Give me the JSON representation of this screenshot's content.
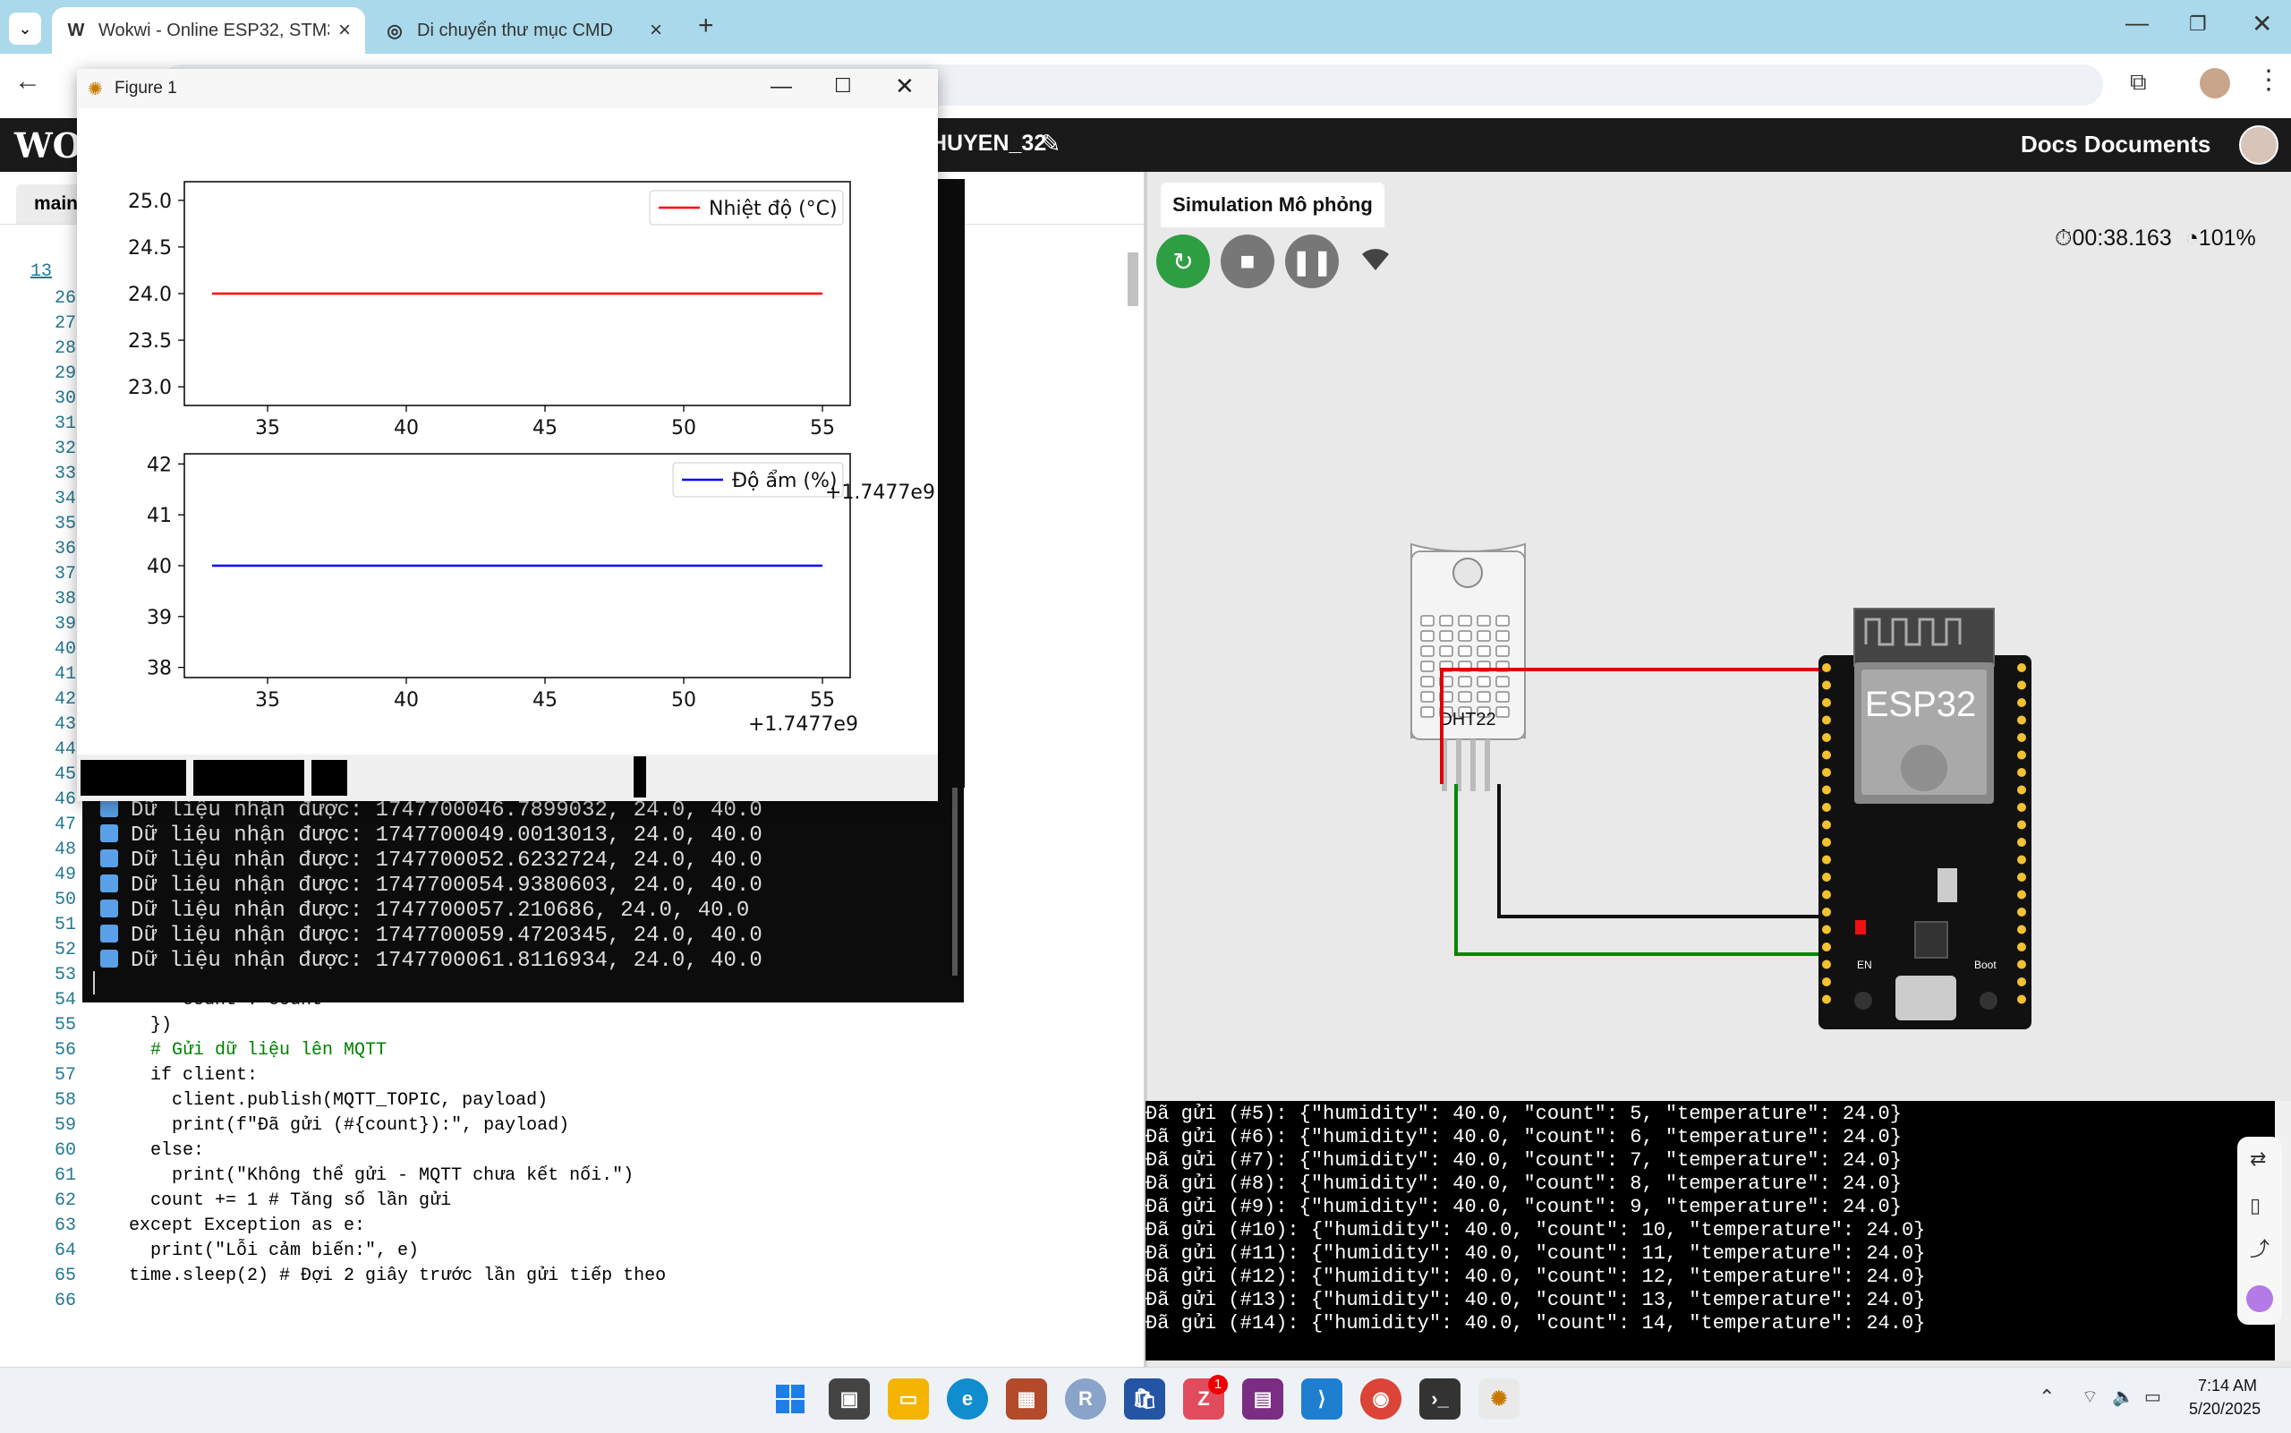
{
  "browser": {
    "tabs": [
      {
        "title": "Wokwi - Online ESP32, STM32,",
        "icon": "wokwi-icon"
      },
      {
        "title": "Di chuyển thư mục CMD",
        "icon": "openai-icon"
      }
    ]
  },
  "wokwi": {
    "logo": "WOK",
    "project_name": "HUYEN_32",
    "docs_label": "Docs Documents",
    "editor_tab": "main",
    "simulation_tab": "Simulation Mô phỏng",
    "timer": "00:38.163",
    "speed": "101%"
  },
  "editor": {
    "first_gutter": "13",
    "lines": [
      {
        "n": "26",
        "t": ""
      },
      {
        "n": "27",
        "t": ""
      },
      {
        "n": "28",
        "t": ""
      },
      {
        "n": "29",
        "t": ""
      },
      {
        "n": "30",
        "t": ""
      },
      {
        "n": "31",
        "t": ""
      },
      {
        "n": "32",
        "t": ""
      },
      {
        "n": "33",
        "t": ""
      },
      {
        "n": "34",
        "t": ""
      },
      {
        "n": "35",
        "t": ""
      },
      {
        "n": "36",
        "t": ""
      },
      {
        "n": "37",
        "t": ""
      },
      {
        "n": "38",
        "t": ""
      },
      {
        "n": "39",
        "t": ""
      },
      {
        "n": "40",
        "t": ""
      },
      {
        "n": "41",
        "t": ""
      },
      {
        "n": "42",
        "t": ""
      },
      {
        "n": "43",
        "t": ""
      },
      {
        "n": "44",
        "t": ""
      },
      {
        "n": "45",
        "t": ""
      },
      {
        "n": "46",
        "t": ""
      },
      {
        "n": "47",
        "t": ""
      },
      {
        "n": "48",
        "t": ""
      },
      {
        "n": "49",
        "t": ""
      },
      {
        "n": "50",
        "t": ""
      },
      {
        "n": "51",
        "t": ""
      },
      {
        "n": "52",
        "t": ""
      },
      {
        "n": "53",
        "t": ""
      },
      {
        "n": "54",
        "t": "        \"count\": count"
      },
      {
        "n": "55",
        "t": "      })"
      },
      {
        "n": "56",
        "t": "      # Gửi dữ liệu lên MQTT"
      },
      {
        "n": "57",
        "t": "      if client:"
      },
      {
        "n": "58",
        "t": "        client.publish(MQTT_TOPIC, payload)"
      },
      {
        "n": "59",
        "t": "        print(f\"Đã gửi (#{count}):\", payload)"
      },
      {
        "n": "60",
        "t": "      else:"
      },
      {
        "n": "61",
        "t": "        print(\"Không thể gửi - MQTT chưa kết nối.\")"
      },
      {
        "n": "62",
        "t": "      count += 1 # Tăng số lần gửi"
      },
      {
        "n": "63",
        "t": "    except Exception as e:"
      },
      {
        "n": "64",
        "t": "      print(\"Lỗi cảm biến:\", e)"
      },
      {
        "n": "65",
        "t": "    time.sleep(2) # Đợi 2 giây trước lần gửi tiếp theo"
      },
      {
        "n": "66",
        "t": ""
      }
    ]
  },
  "terminal": {
    "lines": [
      "Dữ liệu nhận được: 1747700046.7899032, 24.0, 40.0",
      "Dữ liệu nhận được: 1747700049.0013013, 24.0, 40.0",
      "Dữ liệu nhận được: 1747700052.6232724, 24.0, 40.0",
      "Dữ liệu nhận được: 1747700054.9380603, 24.0, 40.0",
      "Dữ liệu nhận được: 1747700057.210686, 24.0, 40.0",
      "Dữ liệu nhận được: 1747700059.4720345, 24.0, 40.0",
      "Dữ liệu nhận được: 1747700061.8116934, 24.0, 40.0"
    ]
  },
  "figure": {
    "window_title": "Figure 1",
    "offset_label": "+1.7477e9"
  },
  "chart_data": [
    {
      "type": "line",
      "series": [
        {
          "name": "Nhiệt độ (°C)",
          "color": "#ff0000",
          "x": [
            33,
            55
          ],
          "y": [
            24.0,
            24.0
          ]
        }
      ],
      "xlim": [
        32,
        56
      ],
      "ylim": [
        22.8,
        25.2
      ],
      "xticks": [
        35,
        40,
        45,
        50,
        55
      ],
      "yticks": [
        25.0,
        24.5,
        24.0,
        23.5,
        23.0
      ],
      "xtick_labels": [
        "35",
        "40",
        "45",
        "50",
        "55"
      ],
      "ytick_labels": [
        "25.0",
        "24.5",
        "24.0",
        "23.5",
        "23.0"
      ],
      "legend": "top-right"
    },
    {
      "type": "line",
      "series": [
        {
          "name": "Độ ẩm (%)",
          "color": "#0000ff",
          "x": [
            33,
            55
          ],
          "y": [
            40,
            40
          ]
        }
      ],
      "xlim": [
        32,
        56
      ],
      "ylim": [
        37.8,
        42.2
      ],
      "xticks": [
        35,
        40,
        45,
        50,
        55
      ],
      "yticks": [
        42,
        41,
        40,
        39,
        38
      ],
      "xtick_labels": [
        "35",
        "40",
        "45",
        "50",
        "55"
      ],
      "ytick_labels": [
        "42",
        "41",
        "40",
        "39",
        "38"
      ],
      "legend": "top-right"
    }
  ],
  "simulation": {
    "sensor_label": "DHT22",
    "board_label": "ESP32",
    "en_label": "EN",
    "boot_label": "Boot"
  },
  "serial": {
    "lines": [
      "Đã gửi (#5): {\"humidity\": 40.0, \"count\": 5, \"temperature\": 24.0}",
      "Đã gửi (#6): {\"humidity\": 40.0, \"count\": 6, \"temperature\": 24.0}",
      "Đã gửi (#7): {\"humidity\": 40.0, \"count\": 7, \"temperature\": 24.0}",
      "Đã gửi (#8): {\"humidity\": 40.0, \"count\": 8, \"temperature\": 24.0}",
      "Đã gửi (#9): {\"humidity\": 40.0, \"count\": 9, \"temperature\": 24.0}",
      "Đã gửi (#10): {\"humidity\": 40.0, \"count\": 10, \"temperature\": 24.0}",
      "Đã gửi (#11): {\"humidity\": 40.0, \"count\": 11, \"temperature\": 24.0}",
      "Đã gửi (#12): {\"humidity\": 40.0, \"count\": 12, \"temperature\": 24.0}",
      "Đã gửi (#13): {\"humidity\": 40.0, \"count\": 13, \"temperature\": 24.0}",
      "Đã gửi (#14): {\"humidity\": 40.0, \"count\": 14, \"temperature\": 24.0}"
    ]
  },
  "taskbar": {
    "zalo_badge": "1",
    "r_label": "R",
    "clock_time": "7:14 AM",
    "clock_date": "5/20/2025"
  }
}
